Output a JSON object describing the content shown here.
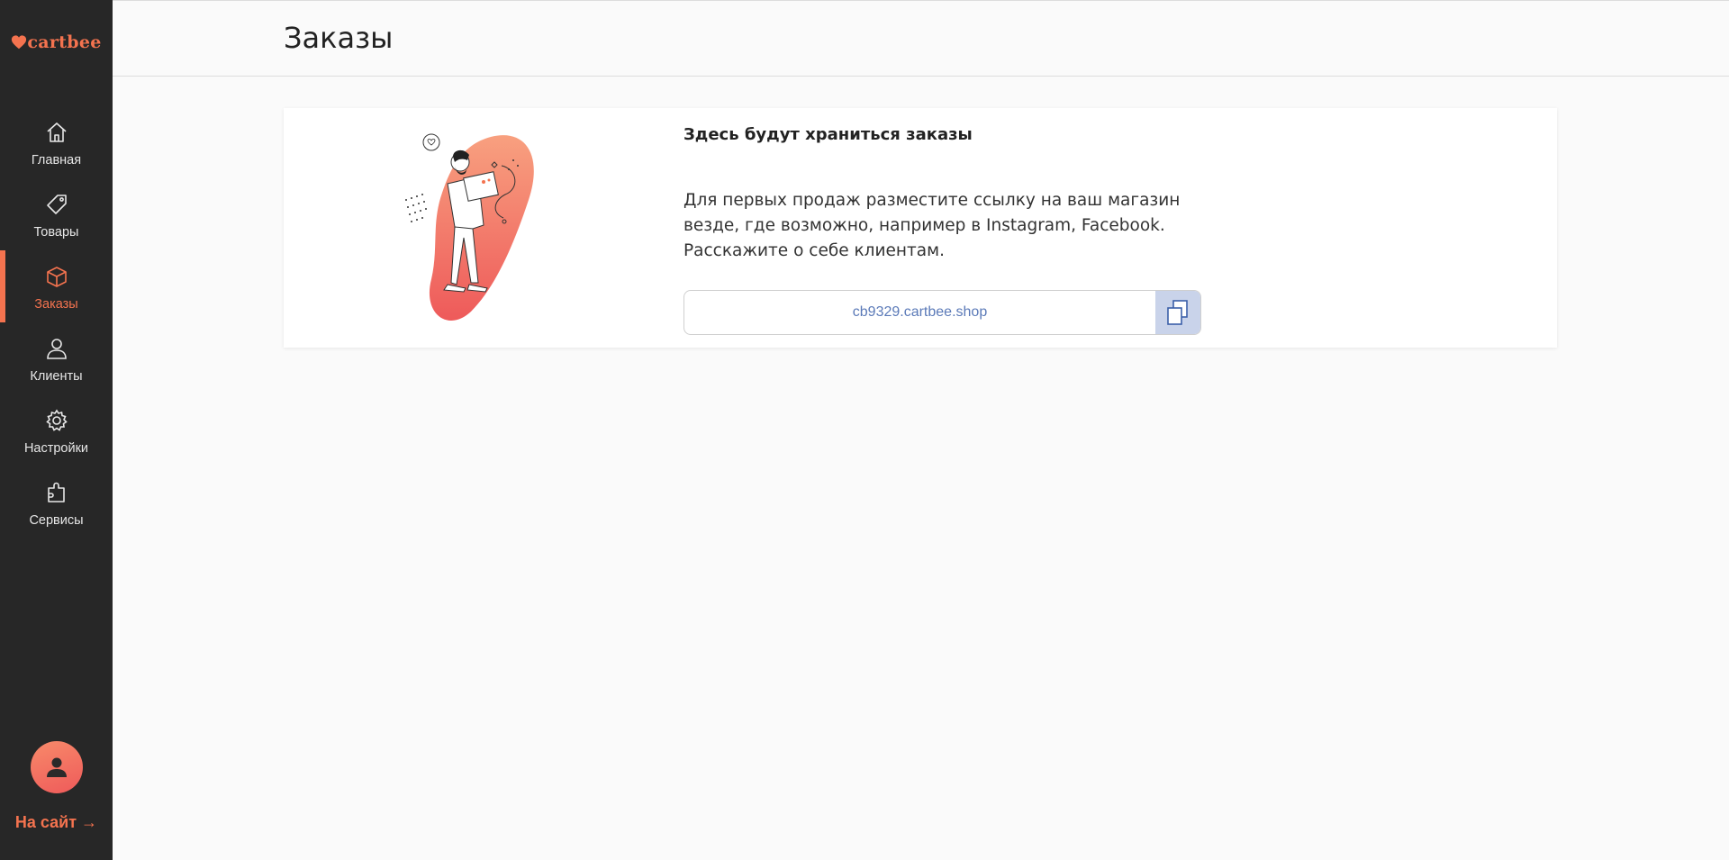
{
  "app": {
    "logo": "cartbee"
  },
  "sidebar": {
    "items": [
      {
        "label": "Главная",
        "icon": "home-icon"
      },
      {
        "label": "Товары",
        "icon": "tag-icon"
      },
      {
        "label": "Заказы",
        "icon": "box-icon",
        "active": true
      },
      {
        "label": "Клиенты",
        "icon": "user-icon"
      },
      {
        "label": "Настройки",
        "icon": "gear-icon"
      },
      {
        "label": "Сервисы",
        "icon": "puzzle-icon"
      }
    ],
    "to_site": "На сайт →"
  },
  "header": {
    "title": "Заказы"
  },
  "empty_state": {
    "title": "Здесь будут храниться заказы",
    "description": "Для первых продаж разместите ссылку на ваш магазин везде, где возможно, например в Instagram, Facebook. Расскажите о себе клиентам.",
    "shop_link": "cb9329.cartbee.shop"
  },
  "colors": {
    "accent": "#f4734f",
    "sidebar_bg": "#272727",
    "link": "#5b7ab8",
    "copy_bg": "#c9d3ea"
  }
}
